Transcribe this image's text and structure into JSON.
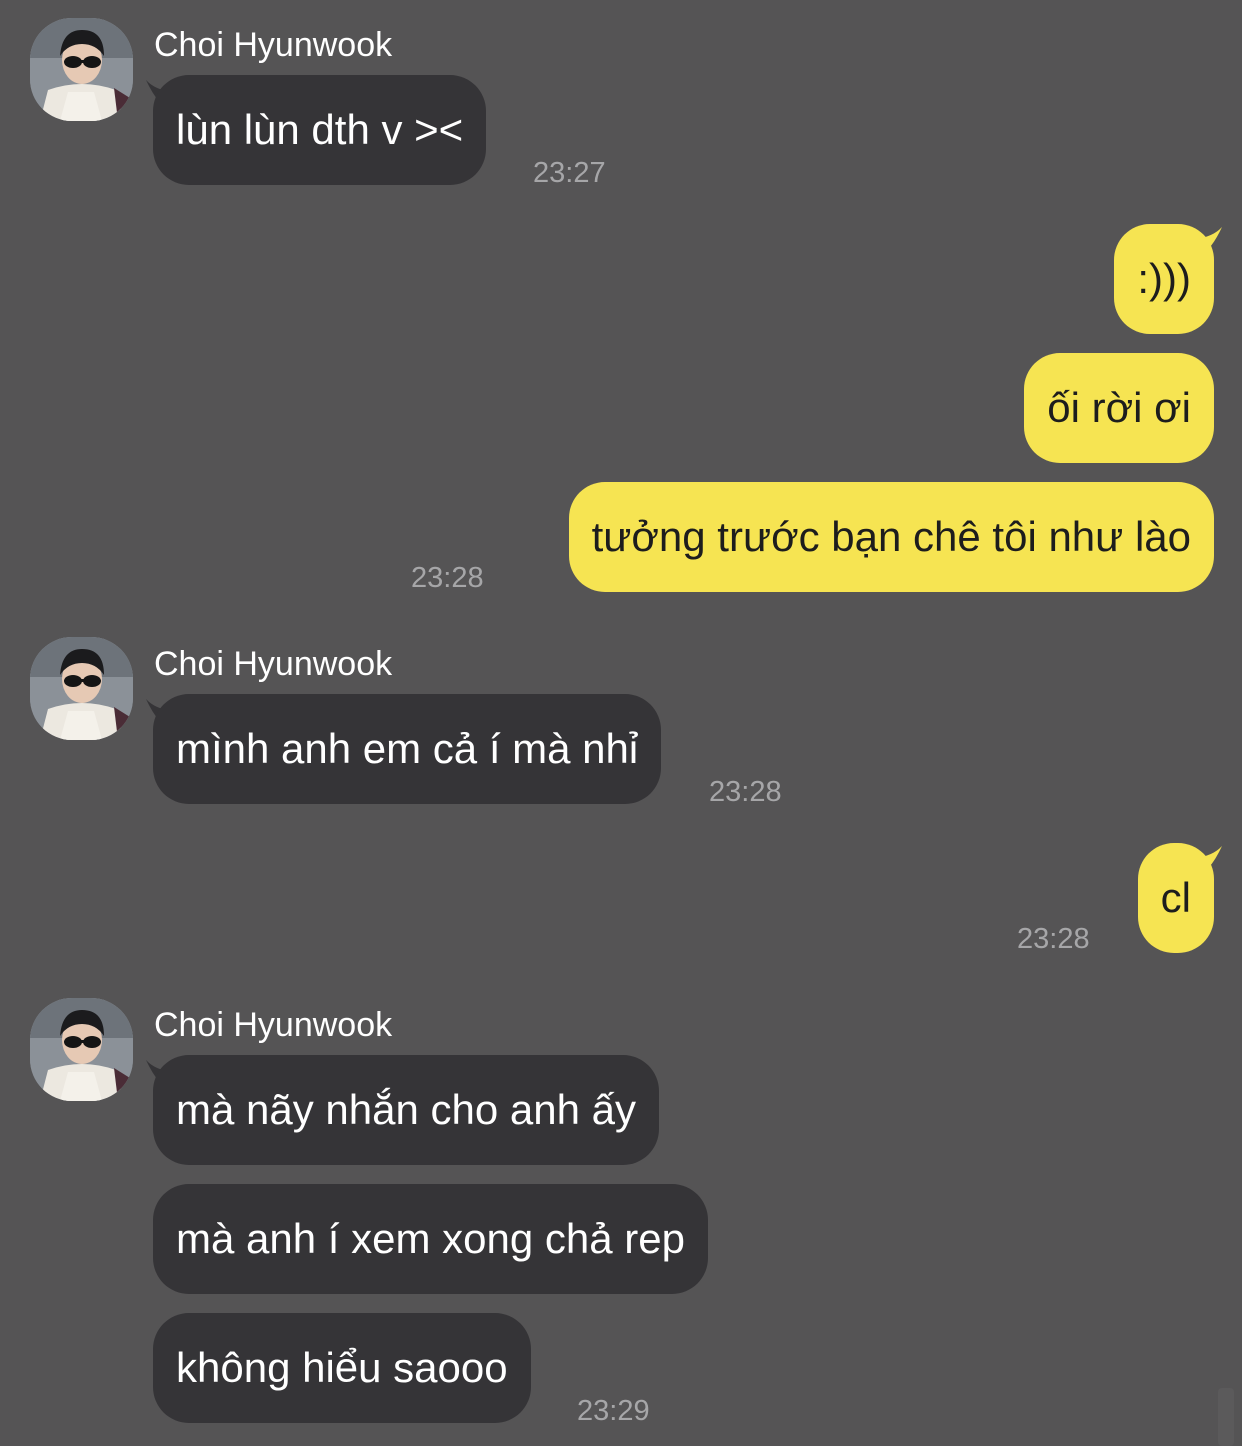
{
  "sender_name": "Choi Hyunwook",
  "groups": [
    {
      "sender": "Choi Hyunwook",
      "messages": [
        "lùn lùn dth v ><"
      ],
      "time": "23:27"
    },
    {
      "me": true,
      "messages": [
        ":)))",
        "ối rời ơi",
        "tưởng trước bạn chê tôi như lào"
      ],
      "time": "23:28"
    },
    {
      "sender": "Choi Hyunwook",
      "messages": [
        "mình anh em cả í mà nhỉ"
      ],
      "time": "23:28"
    },
    {
      "me": true,
      "messages": [
        "cl"
      ],
      "time": "23:28"
    },
    {
      "sender": "Choi Hyunwook",
      "messages": [
        "mà nãy nhắn cho anh ấy",
        "mà anh í xem xong chả rep",
        "không hiểu saooo"
      ],
      "time": "23:29"
    }
  ],
  "colors": {
    "background": "#555455",
    "incoming_bubble": "#353437",
    "outgoing_bubble": "#f6e452",
    "timestamp": "#a6a6a8"
  }
}
